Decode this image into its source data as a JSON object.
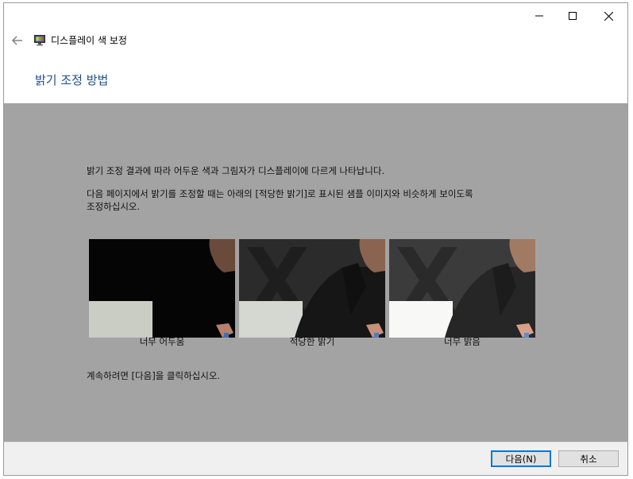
{
  "window": {
    "title": "디스플레이 색 보정",
    "controls": {
      "minimize_icon": "minimize-icon",
      "maximize_icon": "maximize-icon",
      "close_icon": "close-icon"
    }
  },
  "page": {
    "title": "밝기 조정 방법",
    "paragraph1": "밝기 조정 결과에 따라 어두운 색과 그림자가 디스플레이에 다르게 나타납니다.",
    "paragraph2_line1": "다음 페이지에서 밝기를 조정할 때는 아래의 [적당한 밝기]로 표시된 샘플 이미지와 비슷하게 보이도록",
    "paragraph2_line2": "조정하십시오.",
    "instruction": "계속하려면 [다음]을 클릭하십시오."
  },
  "samples": [
    {
      "label": "너무 어두움",
      "brightness": "too-dark"
    },
    {
      "label": "적당한 밝기",
      "brightness": "appropriate"
    },
    {
      "label": "너무 밝음",
      "brightness": "too-bright"
    }
  ],
  "footer": {
    "next_label": "다음(N)",
    "cancel_label": "취소"
  },
  "colors": {
    "title_blue": "#1f4e8c",
    "content_gray": "#a3a3a3",
    "default_button_border": "#0078d7"
  }
}
